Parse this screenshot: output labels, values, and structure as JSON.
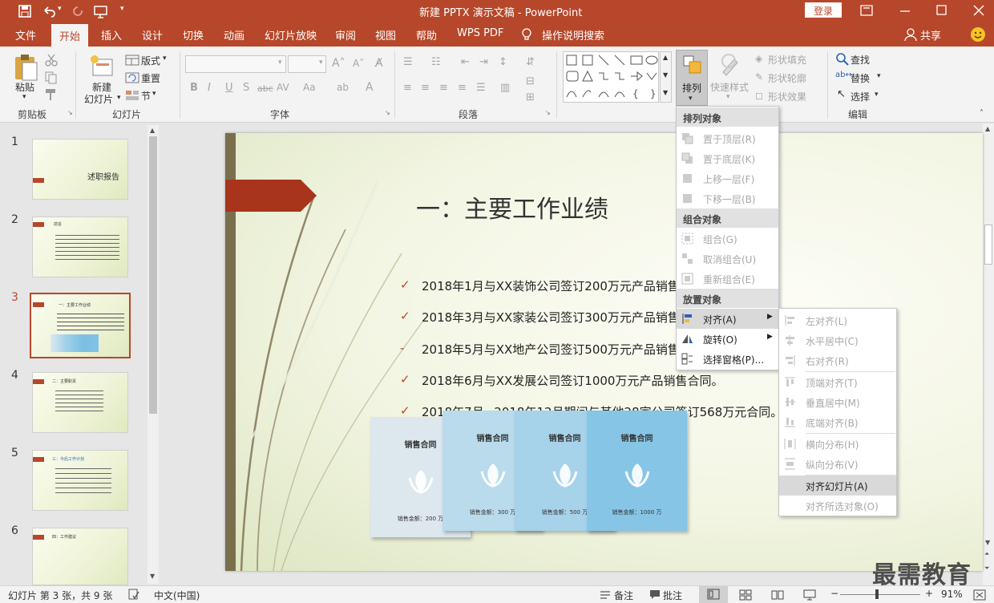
{
  "window": {
    "title": "新建 PPTX 演示文稿 - PowerPoint",
    "login": "登录"
  },
  "tabs": [
    {
      "label": "文件"
    },
    {
      "label": "开始"
    },
    {
      "label": "插入"
    },
    {
      "label": "设计"
    },
    {
      "label": "切换"
    },
    {
      "label": "动画"
    },
    {
      "label": "幻灯片放映"
    },
    {
      "label": "审阅"
    },
    {
      "label": "视图"
    },
    {
      "label": "帮助"
    },
    {
      "label": "WPS PDF"
    },
    {
      "label": "操作说明搜索"
    }
  ],
  "share": "共享",
  "ribbon": {
    "groups": {
      "clipboard": "剪贴板",
      "slides": "幻灯片",
      "font": "字体",
      "paragraph": "段落",
      "editing": "编辑"
    },
    "paste": "粘贴",
    "new_slide_1": "新建",
    "new_slide_2": "幻灯片",
    "layout": "版式",
    "reset": "重置",
    "section": "节",
    "arrange": "排列",
    "quick_styles": "快速样式",
    "shape_fill": "形状填充",
    "shape_outline": "形状轮廓",
    "shape_effects": "形状效果",
    "find": "查找",
    "replace": "替换",
    "select": "选择"
  },
  "slides": [
    {
      "num": "1",
      "title": "述职报告"
    },
    {
      "num": "2",
      "title": "前言"
    },
    {
      "num": "3",
      "title": "一：主要工作业绩"
    },
    {
      "num": "4",
      "title": "二：主要职责"
    },
    {
      "num": "5",
      "title": "三：今后工作计划"
    },
    {
      "num": "6",
      "title": "四：工作建议"
    }
  ],
  "slide": {
    "title": "一：主要工作业绩",
    "bullets": [
      {
        "mark": "✓",
        "text": "2018年1月与XX装饰公司签订200万元产品销售合同。"
      },
      {
        "mark": "✓",
        "text": "2018年3月与XX家装公司签订300万元产品销售合同。"
      },
      {
        "mark": "-",
        "text": "2018年5月与XX地产公司签订500万元产品销售合同。"
      },
      {
        "mark": "✓",
        "text": "2018年6月与XX发展公司签订1000万元产品销售合同。"
      },
      {
        "mark": "✓",
        "text": "2018年7月~2018年12月期间与其他28家公司签订568万元合同。"
      }
    ],
    "docs": [
      {
        "title": "销售合同",
        "amount": "销售金额：200 万"
      },
      {
        "title": "销售合同",
        "amount": "销售金额：300 万"
      },
      {
        "title": "销售合同",
        "amount": "销售金额：500 万"
      },
      {
        "title": "销售合同",
        "amount": "销售金额：1000 万"
      }
    ]
  },
  "arrange_menu": {
    "sec_order": "排列对象",
    "bring_front": "置于顶层(R)",
    "send_back": "置于底层(K)",
    "bring_forward": "上移一层(F)",
    "send_backward": "下移一层(B)",
    "sec_group": "组合对象",
    "group": "组合(G)",
    "ungroup": "取消组合(U)",
    "regroup": "重新组合(E)",
    "sec_position": "放置对象",
    "align": "对齐(A)",
    "rotate": "旋转(O)",
    "selection_pane": "选择窗格(P)..."
  },
  "align_menu": {
    "left": "左对齐(L)",
    "center": "水平居中(C)",
    "right": "右对齐(R)",
    "top": "顶端对齐(T)",
    "middle": "垂直居中(M)",
    "bottom": "底端对齐(B)",
    "dist_h": "横向分布(H)",
    "dist_v": "纵向分布(V)",
    "to_slide": "对齐幻灯片(A)",
    "to_selected": "对齐所选对象(O)"
  },
  "status": {
    "slide_info": "幻灯片 第 3 张，共 9 张",
    "language": "中文(中国)",
    "notes": "备注",
    "comments": "批注",
    "zoom": "91%"
  },
  "watermark": "最需教育",
  "colors": {
    "accent": "#b7472a",
    "slide_bg": "#f2f5e2"
  }
}
